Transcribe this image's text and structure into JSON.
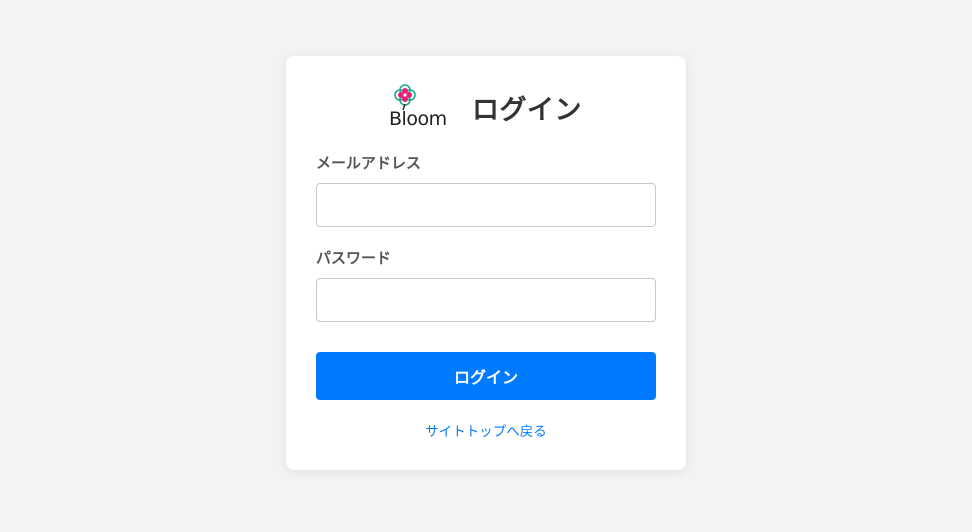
{
  "logo": {
    "text": "Bloom",
    "icon": "flower-icon",
    "colors": {
      "petal_pink": "#e8207a",
      "petal_teal": "#1aa88a",
      "ink": "#222222"
    }
  },
  "header": {
    "title": "ログイン"
  },
  "form": {
    "email_label": "メールアドレス",
    "email_value": "",
    "password_label": "パスワード",
    "password_value": "",
    "submit_label": "ログイン"
  },
  "footer": {
    "back_link": "サイトトップへ戻る"
  },
  "colors": {
    "accent": "#007bff",
    "background": "#f3f3f3",
    "card": "#ffffff"
  }
}
